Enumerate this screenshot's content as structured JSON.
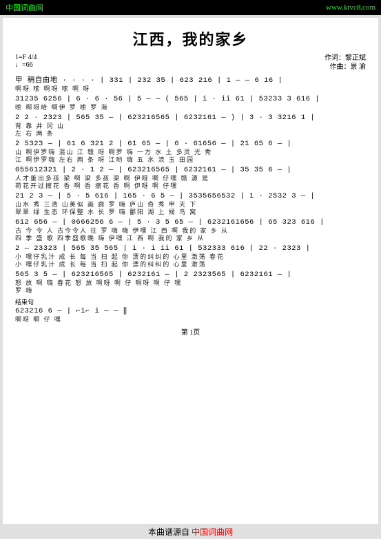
{
  "header": {
    "left": "中国词曲网",
    "right": "www.ktvc8.com"
  },
  "title": "江西，我的家乡",
  "meta": {
    "key": "1=F",
    "timesig": "4/4",
    "tempo": "♩=66",
    "expression": "稍自由地",
    "composer1": "作词：黎正斌",
    "composer2": "作曲：景  渝"
  },
  "lines": [
    {
      "n": "甲  稍自由地  · · · · | 331 | 232 35 | 623 216 | 1 ― ― 6 16 |",
      "l1": "                啊呀    嗦     啊呀    嗦    啊  呀",
      "l2": ""
    },
    {
      "n": "31235 6256 | 6 · 6 · 56 | 5 ― ― ( 565 | i · ii 61 | 53233 3 616 |",
      "l1": "嗦 啊呀哈  啊伊 罗   嗦      罗   海",
      "l2": ""
    },
    {
      "n": "2 2 · 2323 | 565 35 ― | 623216565 | 6232161 ― ) | 3 · 3 3216 1 |",
      "l1": "                                          背 靠 井 冈 山",
      "l2": "                                          左 右 两 条"
    },
    {
      "n": "2 5323 ― | 61 6 321 2 | 61 65 ― | 6 · 61656 ― | 21 65 6 ― |",
      "l1": "山  啊伊罗嗨  混山 江  赣 呀 啊罗  嗨  一方  水      土    多灵      光      秀",
      "l2": "江  啊伊罗嗨  左右 两  条 呀 江哟  嗨  五 水 流      玉    田园      "
    },
    {
      "n": "055612321 | 2 · 1 2 ― | 623216565 | 6232161 ― | 35 35 6 ― |",
      "l1": "人才董出多孩        梁  啊   梁     多孩  梁  啊  伊呀 啊 仔嘿     赣      源 是",
      "l2": "荷花开过擦花        香  啊   香     擦花  香  啊  伊呀 啊 仔嘿     "
    },
    {
      "n": "21  2 3 ― | 5 · 5 616 | 165 · 6 5 ― | 3535656532 | 1 · 2532 3 ― |",
      "l1": "山水     秀  三清 山美似 画   廊 罗 嗨   庐山  奇    秀    甲   天    下",
      "l2": "翠翠     绿  生态 环保整 水   长 罗 嗨   鄱阳    湖  上    候   鸟    窝"
    },
    {
      "n": "612 656 ― | 0666256 6 ― | 5 · 3 5 65 ― | 6232161656 | 65 323 616 |",
      "l1": "古 今 令 人  古今令人  往  罗  嗨   嗨  伊嘿    江 西 啊  我的 家 乡 从",
      "l2": "四 季 盛 歌  四季盛歌晚          嗨  伊嘿    江 西 啊  我的 家 乡 从"
    },
    {
      "n": "2 ― 23323 | 565 35 565 | i · i ii 61 | 532333 616 | 22 ·  2323 |",
      "l1": "小      嘿仔乳汁  成   长 每  当   扫  起 你  漂的纠纠的  心里  激荡  春花",
      "l2": "小      嘿仔乳汁  成   长 每  当   扫  起 你  漂的纠纠的  心里  激荡  "
    },
    {
      "n": "565 3 5 ― | 623216565 | 6232161 ― | 2   2323565 | 6232161 ― |",
      "l1": "怒 放 啊  嗨   春花  怒   放     啊呀 啊 仔      啊呀 啊 仔 嘿",
      "l2": "罗  嗨    "
    },
    {
      "n": "结束句",
      "l1": "",
      "l2": ""
    },
    {
      "n": "623216 6 ― | ⌐i⌐ i ―  ―  ‖",
      "l1": "啊呀  啊 仔        嘿",
      "l2": ""
    }
  ],
  "pageNum": "第 1页",
  "footer": {
    "black": "本曲谱源自",
    "red": "中国词曲网"
  }
}
